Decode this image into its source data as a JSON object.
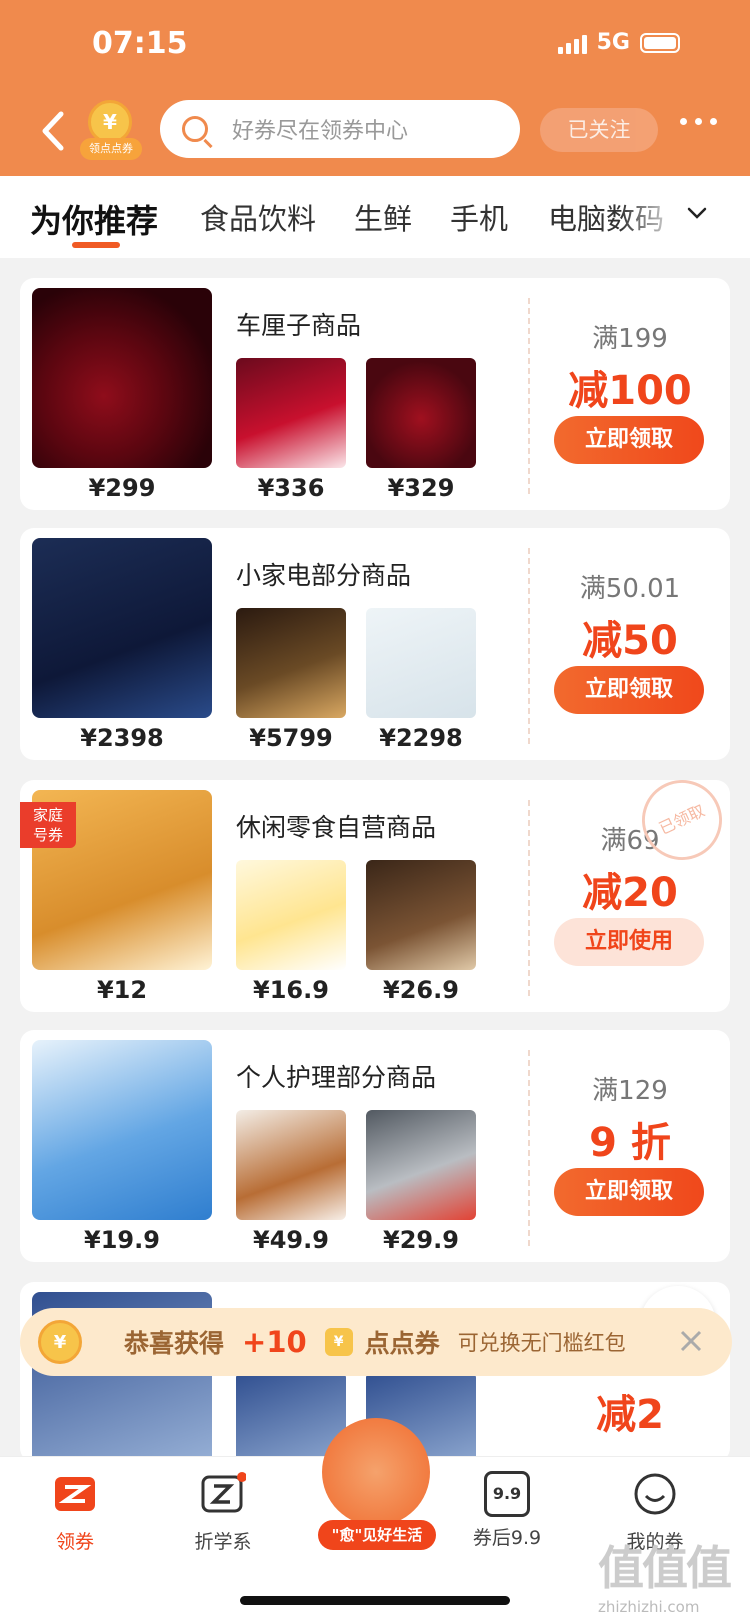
{
  "status_bar": {
    "time": "07:15",
    "network": "5G"
  },
  "header": {
    "coin_badge_label": "领点点券",
    "coin_symbol": "¥",
    "search_placeholder": "好券尽在领券中心",
    "follow_label": "已关注"
  },
  "tabs": [
    {
      "label": "为你推荐",
      "active": true
    },
    {
      "label": "食品饮料"
    },
    {
      "label": "生鲜"
    },
    {
      "label": "手机"
    },
    {
      "label": "电脑数码"
    }
  ],
  "cards": [
    {
      "title": "车厘子商品",
      "big_price": "¥299",
      "small_prices": [
        "¥336",
        "¥329"
      ],
      "threshold": "满199",
      "discount": "减100",
      "button": "立即领取"
    },
    {
      "title": "小家电部分商品",
      "big_price": "¥2398",
      "small_prices": [
        "¥5799",
        "¥2298"
      ],
      "threshold": "满50.01",
      "discount": "减50",
      "button": "立即领取"
    },
    {
      "title": "休闲零食自营商品",
      "big_price": "¥12",
      "small_prices": [
        "¥16.9",
        "¥26.9"
      ],
      "threshold": "满69",
      "discount": "减20",
      "button": "立即使用",
      "tag": "家庭\n号券",
      "stamp": "已领取"
    },
    {
      "title": "个人护理部分商品",
      "big_price": "¥19.9",
      "small_prices": [
        "¥49.9",
        "¥29.9"
      ],
      "threshold": "满129",
      "discount": "9 折",
      "button": "立即领取"
    }
  ],
  "partial_card": {
    "discount": "减2"
  },
  "toast": {
    "text1": "恭喜获得",
    "amount": "+10",
    "coin_label": "点点券",
    "desc": "可兑换无门槛红包"
  },
  "bottom_nav": [
    {
      "label": "领券",
      "active": true
    },
    {
      "label": "折学系"
    },
    {
      "label": "\"愈\"见好生活"
    },
    {
      "label": "券后9.9",
      "icon_text": "9.9"
    },
    {
      "label": "我的券"
    }
  ],
  "watermark": {
    "logo": "值值值",
    "url": "zhizhizhi.com"
  },
  "colors": {
    "brand_orange": "#f08a4d",
    "accent_red": "#f0451b"
  }
}
